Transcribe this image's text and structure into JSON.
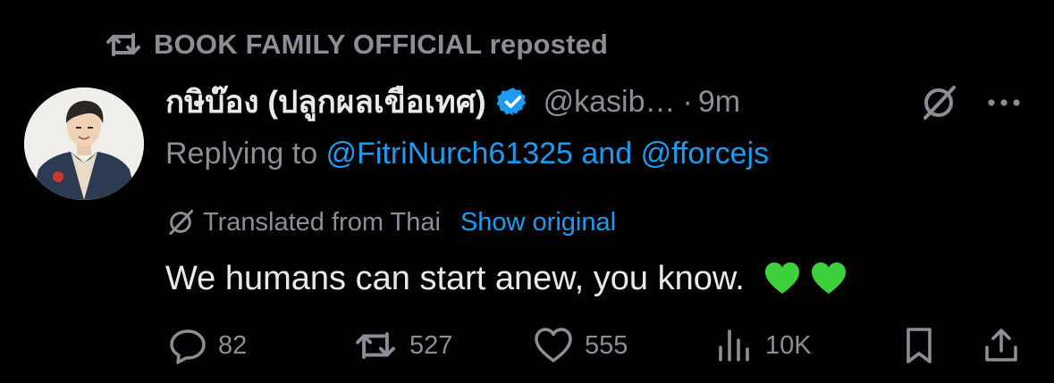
{
  "repost": {
    "label": "BOOK FAMILY OFFICIAL reposted",
    "icon": "repost-icon"
  },
  "author": {
    "display_name": "กษิบ๊อง (ปลูกผลเขือเทศ)",
    "handle": "@kasib…",
    "separator": "·",
    "time": "9m",
    "verified": true,
    "verified_color": "#1d9bf0"
  },
  "reply": {
    "prefix": "Replying to ",
    "user1": "@FitriNurch61325",
    "joiner": " and ",
    "user2": "@fforcejs"
  },
  "translation": {
    "label": "Translated from Thai",
    "action": "Show original",
    "icon": "translate-icon"
  },
  "tweet": {
    "text": "We humans can start anew, you know.",
    "emoji": [
      "green-heart",
      "green-heart"
    ]
  },
  "actions": {
    "replies": "82",
    "reposts": "527",
    "likes": "555",
    "views": "10K"
  },
  "colors": {
    "background": "#000000",
    "text": "#e7e9ea",
    "muted": "#8b8f95",
    "link": "#1d9bf0",
    "heart": "#3ecf3c"
  }
}
